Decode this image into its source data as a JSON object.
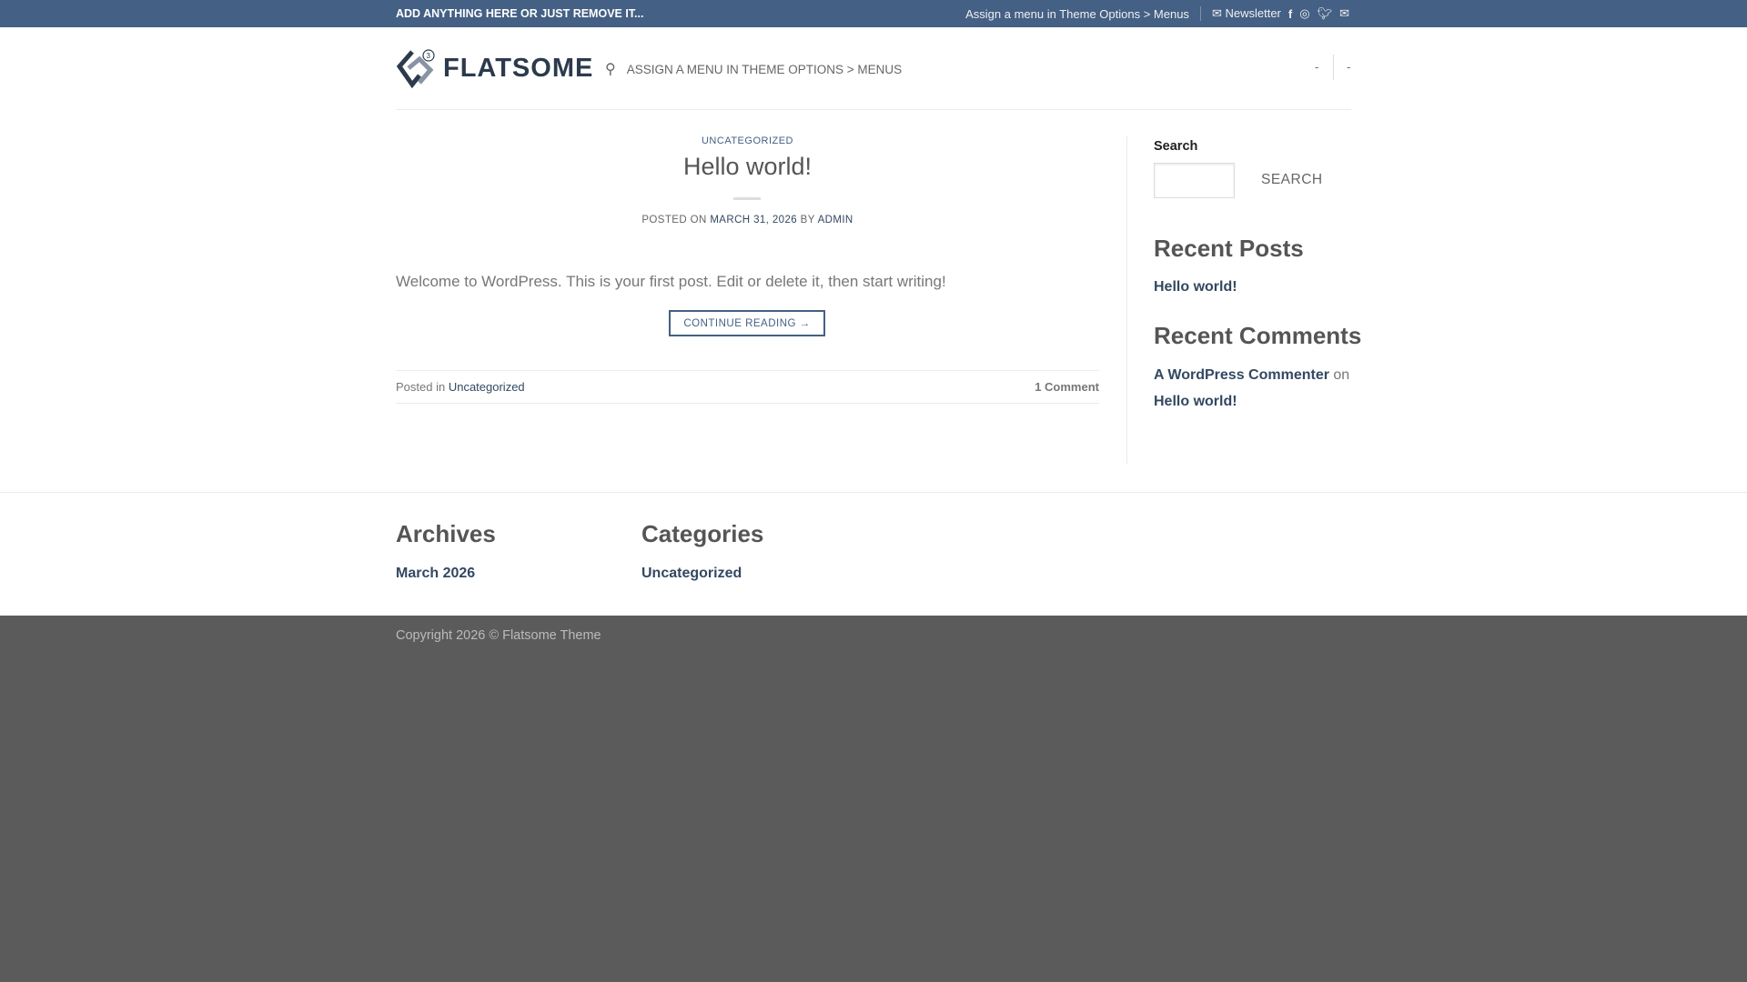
{
  "topbar": {
    "left_text": "ADD ANYTHING HERE OR JUST REMOVE IT...",
    "menu_note": "Assign a menu in Theme Options > Menus",
    "newsletter": "Newsletter"
  },
  "header": {
    "logo": "FLATSOME",
    "nav_note": "ASSIGN A MENU IN THEME OPTIONS > MENUS",
    "right_items": [
      "-",
      "-"
    ]
  },
  "post": {
    "category": "UNCATEGORIZED",
    "title": "Hello world!",
    "posted_on": "POSTED ON",
    "date": "MARCH 31, 2026",
    "by": "BY",
    "author": "ADMIN",
    "excerpt": "Welcome to WordPress. This is your first post. Edit or delete it, then start writing!",
    "continue": "CONTINUE READING →",
    "posted_in": "Posted in",
    "posted_in_cat": "Uncategorized",
    "comments": "1 Comment"
  },
  "sidebar": {
    "search_label": "Search",
    "search_value": "",
    "search_button": "SEARCH",
    "recent_posts_title": "Recent Posts",
    "recent_posts": [
      "Hello world!"
    ],
    "recent_comments_title": "Recent Comments",
    "comment_author": "A WordPress Commenter",
    "comment_on": "on",
    "comment_post": "Hello world!"
  },
  "footer": {
    "archives_title": "Archives",
    "archives": [
      "March 2026"
    ],
    "categories_title": "Categories",
    "categories": [
      "Uncategorized"
    ],
    "copyright": "Copyright 2026 © Flatsome Theme"
  },
  "colors": {
    "primary": "#446084",
    "link": "#334862",
    "footer": "#5b5b5b"
  }
}
